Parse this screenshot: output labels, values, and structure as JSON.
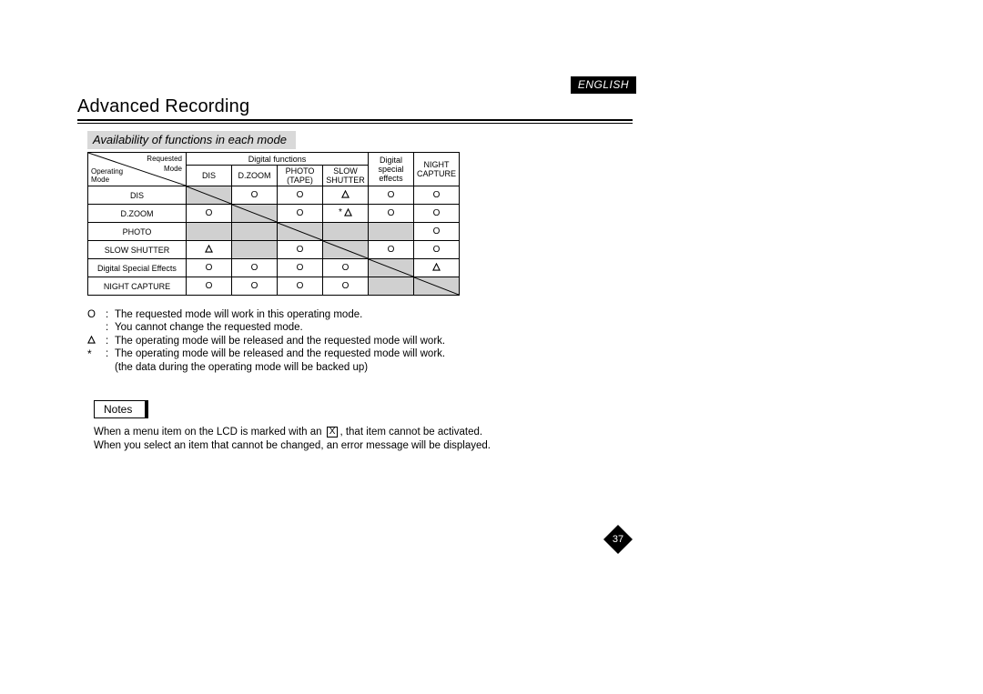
{
  "language": "ENGLISH",
  "title": "Advanced Recording",
  "subtitle": "Availability of functions in each mode",
  "header": {
    "diag_top1": "Requested",
    "diag_top2": "Mode",
    "diag_bot1": "Operating",
    "diag_bot2": "Mode",
    "group_digital": "Digital functions",
    "c1": "DIS",
    "c2": "D.ZOOM",
    "c3a": "PHOTO",
    "c3b": "(TAPE)",
    "c4a": "SLOW",
    "c4b": "SHUTTER",
    "c5a": "Digital",
    "c5b": "special",
    "c5c": "effects",
    "c6a": "NIGHT",
    "c6b": "CAPTURE"
  },
  "rows": [
    {
      "label": "DIS",
      "cells": [
        "diag",
        "O",
        "O",
        "tri",
        "O",
        "O"
      ]
    },
    {
      "label": "D.ZOOM",
      "cells": [
        "O",
        "diag",
        "O",
        "star-tri",
        "O",
        "O"
      ]
    },
    {
      "label": "PHOTO",
      "cells": [
        "",
        "",
        "diag",
        "",
        "",
        "O"
      ],
      "shaded": [
        0,
        1,
        3,
        4
      ]
    },
    {
      "label": "SLOW SHUTTER",
      "cells": [
        "tri",
        "",
        "O",
        "diag",
        "O",
        "O"
      ],
      "shaded": [
        1
      ]
    },
    {
      "label": "Digital Special Effects",
      "cells": [
        "O",
        "O",
        "O",
        "O",
        "diag",
        "tri"
      ]
    },
    {
      "label": "NIGHT CAPTURE",
      "cells": [
        "O",
        "O",
        "O",
        "O",
        "",
        "diag"
      ],
      "shaded": [
        4
      ]
    }
  ],
  "legend": {
    "o": "The requested mode will work in this operating mode.",
    "o2": "You cannot change the requested mode.",
    "tri": "The operating mode will be released and the requested mode will work.",
    "star": "The operating mode will be released and the requested mode will work.",
    "star2": "(the data during the operating mode will be backed up)"
  },
  "notes": {
    "label": "Notes",
    "l1a": "When a menu item on the LCD is marked with an ",
    "l1b": ", that item cannot be activated.",
    "l2": "When you select an item that cannot be changed, an error message will be displayed."
  },
  "page_number": "37",
  "chart_data": {
    "type": "table",
    "title": "Availability of functions in each mode",
    "columns": [
      "DIS",
      "D.ZOOM",
      "PHOTO (TAPE)",
      "SLOW SHUTTER",
      "Digital special effects",
      "NIGHT CAPTURE"
    ],
    "rows": [
      "DIS",
      "D.ZOOM",
      "PHOTO",
      "SLOW SHUTTER",
      "Digital Special Effects",
      "NIGHT CAPTURE"
    ],
    "values": [
      [
        "—",
        "O",
        "O",
        "△",
        "O",
        "O"
      ],
      [
        "O",
        "—",
        "O",
        "* △",
        "O",
        "O"
      ],
      [
        "",
        "",
        "—",
        "",
        "",
        "O"
      ],
      [
        "△",
        "",
        "O",
        "—",
        "O",
        "O"
      ],
      [
        "O",
        "O",
        "O",
        "O",
        "—",
        "△"
      ],
      [
        "O",
        "O",
        "O",
        "O",
        "",
        "—"
      ]
    ],
    "legend": {
      "O": "The requested mode will work in this operating mode. You cannot change the requested mode.",
      "△": "The operating mode will be released and the requested mode will work.",
      "*": "The operating mode will be released and the requested mode will work. (the data during the operating mode will be backed up)",
      "—": "diagonal (same mode)",
      "": "not available (shaded)"
    }
  }
}
